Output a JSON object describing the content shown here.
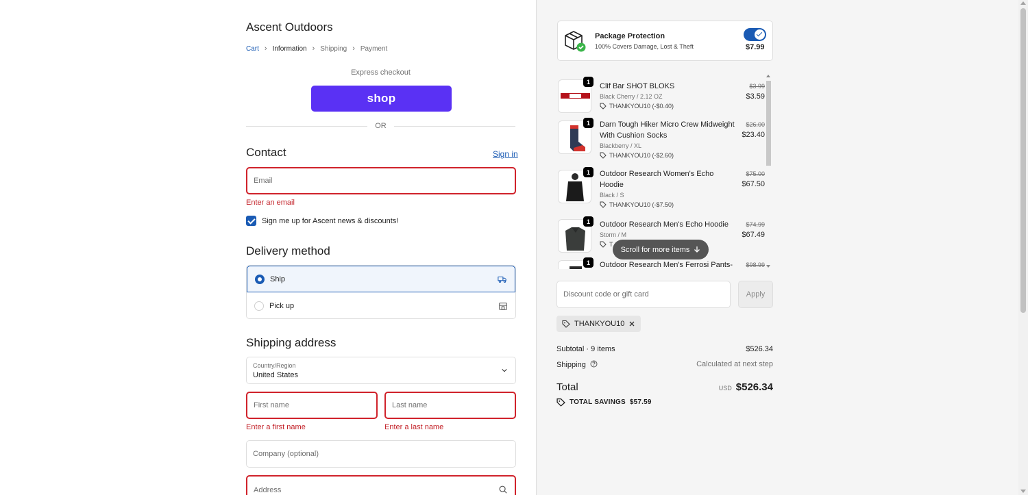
{
  "store": {
    "name": "Ascent Outdoors"
  },
  "breadcrumb": {
    "cart": "Cart",
    "information": "Information",
    "shipping": "Shipping",
    "payment": "Payment"
  },
  "express": {
    "label": "Express checkout",
    "shop_button": "shop",
    "or": "OR"
  },
  "contact": {
    "title": "Contact",
    "signin": "Sign in",
    "email_placeholder": "Email",
    "email_error": "Enter an email",
    "newsletter_label": "Sign me up for Ascent news & discounts!",
    "newsletter_checked": true
  },
  "delivery": {
    "title": "Delivery method",
    "options": [
      {
        "label": "Ship",
        "selected": true,
        "icon": "truck-icon"
      },
      {
        "label": "Pick up",
        "selected": false,
        "icon": "store-icon"
      }
    ]
  },
  "shipping_address": {
    "title": "Shipping address",
    "country_label": "Country/Region",
    "country_value": "United States",
    "first_name_placeholder": "First name",
    "first_name_error": "Enter a first name",
    "last_name_placeholder": "Last name",
    "last_name_error": "Enter a last name",
    "company_placeholder": "Company (optional)",
    "address_placeholder": "Address"
  },
  "package_protection": {
    "title": "Package Protection",
    "subtitle": "100% Covers Damage, Lost & Theft",
    "price": "$7.99",
    "enabled": true
  },
  "items": [
    {
      "qty": "1",
      "name": "Clif Bar SHOT BLOKS",
      "variant": "Black Cherry / 2.12 OZ",
      "discount": "THANKYOU10 (-$0.40)",
      "old_price": "$3.99",
      "price": "$3.59"
    },
    {
      "qty": "1",
      "name": "Darn Tough Hiker Micro Crew Midweight With Cushion Socks",
      "variant": "Blackberry / XL",
      "discount": "THANKYOU10 (-$2.60)",
      "old_price": "$26.00",
      "price": "$23.40"
    },
    {
      "qty": "1",
      "name": "Outdoor Research Women's Echo Hoodie",
      "variant": "Black / S",
      "discount": "THANKYOU10 (-$7.50)",
      "old_price": "$75.00",
      "price": "$67.50"
    },
    {
      "qty": "1",
      "name": "Outdoor Research Men's Echo Hoodie",
      "variant": "Storm / M",
      "discount": "T",
      "old_price": "$74.99",
      "price": "$67.49"
    },
    {
      "qty": "1",
      "name": "Outdoor Research Men's Ferrosi Pants-",
      "old_price": "$98.99"
    }
  ],
  "scroll_hint": "Scroll for more items",
  "discount": {
    "placeholder": "Discount code or gift card",
    "apply": "Apply",
    "applied_code": "THANKYOU10"
  },
  "summary": {
    "subtotal_label": "Subtotal · 9 items",
    "subtotal_value": "$526.34",
    "shipping_label": "Shipping",
    "shipping_value": "Calculated at next step",
    "total_label": "Total",
    "currency": "USD",
    "total_value": "$526.34",
    "savings_label": "TOTAL SAVINGS",
    "savings_value": "$57.59"
  },
  "colors": {
    "accent": "#1a5bb4",
    "shop": "#5a31f4",
    "error": "#d0222b"
  }
}
